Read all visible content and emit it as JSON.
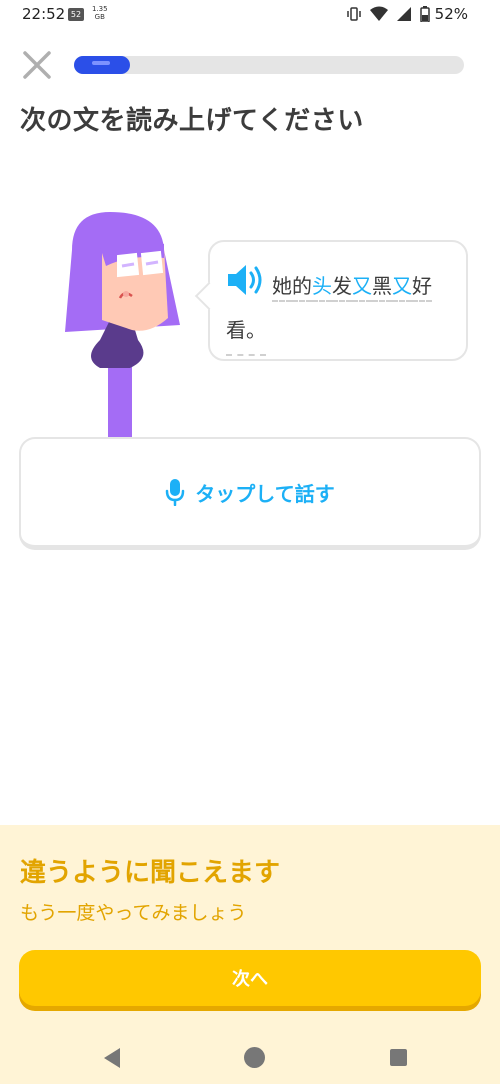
{
  "status_bar": {
    "time": "22:52",
    "notif_badge": "52",
    "data_rate": "1.35",
    "data_unit": "GB",
    "battery": "52%",
    "icons": [
      "vibrate-icon",
      "wifi-icon",
      "signal-icon",
      "battery-icon"
    ]
  },
  "header": {
    "progress": 0.144,
    "close_icon": "close-icon"
  },
  "prompt": {
    "title": "次の文を読み上げてください"
  },
  "bubble": {
    "speaker_icon": "speaker-icon",
    "sentence_parts": [
      "她",
      "的",
      "头",
      "发",
      "又",
      "黑",
      "又",
      "好"
    ],
    "sentence_line2": "看。"
  },
  "speak_button": {
    "icon": "microphone-icon",
    "label": "タップして話す"
  },
  "feedback": {
    "title": "違うように聞こえます",
    "subtitle": "もう一度やってみましょう",
    "next_label": "次へ"
  },
  "colors": {
    "accent_blue": "#1cb0f6",
    "progress_blue": "#2b4fe8",
    "feedback_bg": "#fff4d6",
    "feedback_text": "#e2a400",
    "button_yellow": "#ffc800"
  }
}
